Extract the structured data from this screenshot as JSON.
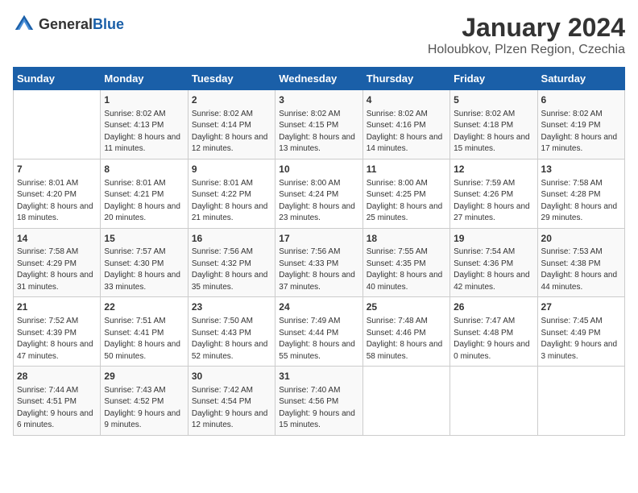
{
  "header": {
    "logo_general": "General",
    "logo_blue": "Blue",
    "title": "January 2024",
    "subtitle": "Holoubkov, Plzen Region, Czechia"
  },
  "days_of_week": [
    "Sunday",
    "Monday",
    "Tuesday",
    "Wednesday",
    "Thursday",
    "Friday",
    "Saturday"
  ],
  "weeks": [
    [
      {
        "day": "",
        "sunrise": "",
        "sunset": "",
        "daylight": ""
      },
      {
        "day": "1",
        "sunrise": "Sunrise: 8:02 AM",
        "sunset": "Sunset: 4:13 PM",
        "daylight": "Daylight: 8 hours and 11 minutes."
      },
      {
        "day": "2",
        "sunrise": "Sunrise: 8:02 AM",
        "sunset": "Sunset: 4:14 PM",
        "daylight": "Daylight: 8 hours and 12 minutes."
      },
      {
        "day": "3",
        "sunrise": "Sunrise: 8:02 AM",
        "sunset": "Sunset: 4:15 PM",
        "daylight": "Daylight: 8 hours and 13 minutes."
      },
      {
        "day": "4",
        "sunrise": "Sunrise: 8:02 AM",
        "sunset": "Sunset: 4:16 PM",
        "daylight": "Daylight: 8 hours and 14 minutes."
      },
      {
        "day": "5",
        "sunrise": "Sunrise: 8:02 AM",
        "sunset": "Sunset: 4:18 PM",
        "daylight": "Daylight: 8 hours and 15 minutes."
      },
      {
        "day": "6",
        "sunrise": "Sunrise: 8:02 AM",
        "sunset": "Sunset: 4:19 PM",
        "daylight": "Daylight: 8 hours and 17 minutes."
      }
    ],
    [
      {
        "day": "7",
        "sunrise": "Sunrise: 8:01 AM",
        "sunset": "Sunset: 4:20 PM",
        "daylight": "Daylight: 8 hours and 18 minutes."
      },
      {
        "day": "8",
        "sunrise": "Sunrise: 8:01 AM",
        "sunset": "Sunset: 4:21 PM",
        "daylight": "Daylight: 8 hours and 20 minutes."
      },
      {
        "day": "9",
        "sunrise": "Sunrise: 8:01 AM",
        "sunset": "Sunset: 4:22 PM",
        "daylight": "Daylight: 8 hours and 21 minutes."
      },
      {
        "day": "10",
        "sunrise": "Sunrise: 8:00 AM",
        "sunset": "Sunset: 4:24 PM",
        "daylight": "Daylight: 8 hours and 23 minutes."
      },
      {
        "day": "11",
        "sunrise": "Sunrise: 8:00 AM",
        "sunset": "Sunset: 4:25 PM",
        "daylight": "Daylight: 8 hours and 25 minutes."
      },
      {
        "day": "12",
        "sunrise": "Sunrise: 7:59 AM",
        "sunset": "Sunset: 4:26 PM",
        "daylight": "Daylight: 8 hours and 27 minutes."
      },
      {
        "day": "13",
        "sunrise": "Sunrise: 7:58 AM",
        "sunset": "Sunset: 4:28 PM",
        "daylight": "Daylight: 8 hours and 29 minutes."
      }
    ],
    [
      {
        "day": "14",
        "sunrise": "Sunrise: 7:58 AM",
        "sunset": "Sunset: 4:29 PM",
        "daylight": "Daylight: 8 hours and 31 minutes."
      },
      {
        "day": "15",
        "sunrise": "Sunrise: 7:57 AM",
        "sunset": "Sunset: 4:30 PM",
        "daylight": "Daylight: 8 hours and 33 minutes."
      },
      {
        "day": "16",
        "sunrise": "Sunrise: 7:56 AM",
        "sunset": "Sunset: 4:32 PM",
        "daylight": "Daylight: 8 hours and 35 minutes."
      },
      {
        "day": "17",
        "sunrise": "Sunrise: 7:56 AM",
        "sunset": "Sunset: 4:33 PM",
        "daylight": "Daylight: 8 hours and 37 minutes."
      },
      {
        "day": "18",
        "sunrise": "Sunrise: 7:55 AM",
        "sunset": "Sunset: 4:35 PM",
        "daylight": "Daylight: 8 hours and 40 minutes."
      },
      {
        "day": "19",
        "sunrise": "Sunrise: 7:54 AM",
        "sunset": "Sunset: 4:36 PM",
        "daylight": "Daylight: 8 hours and 42 minutes."
      },
      {
        "day": "20",
        "sunrise": "Sunrise: 7:53 AM",
        "sunset": "Sunset: 4:38 PM",
        "daylight": "Daylight: 8 hours and 44 minutes."
      }
    ],
    [
      {
        "day": "21",
        "sunrise": "Sunrise: 7:52 AM",
        "sunset": "Sunset: 4:39 PM",
        "daylight": "Daylight: 8 hours and 47 minutes."
      },
      {
        "day": "22",
        "sunrise": "Sunrise: 7:51 AM",
        "sunset": "Sunset: 4:41 PM",
        "daylight": "Daylight: 8 hours and 50 minutes."
      },
      {
        "day": "23",
        "sunrise": "Sunrise: 7:50 AM",
        "sunset": "Sunset: 4:43 PM",
        "daylight": "Daylight: 8 hours and 52 minutes."
      },
      {
        "day": "24",
        "sunrise": "Sunrise: 7:49 AM",
        "sunset": "Sunset: 4:44 PM",
        "daylight": "Daylight: 8 hours and 55 minutes."
      },
      {
        "day": "25",
        "sunrise": "Sunrise: 7:48 AM",
        "sunset": "Sunset: 4:46 PM",
        "daylight": "Daylight: 8 hours and 58 minutes."
      },
      {
        "day": "26",
        "sunrise": "Sunrise: 7:47 AM",
        "sunset": "Sunset: 4:48 PM",
        "daylight": "Daylight: 9 hours and 0 minutes."
      },
      {
        "day": "27",
        "sunrise": "Sunrise: 7:45 AM",
        "sunset": "Sunset: 4:49 PM",
        "daylight": "Daylight: 9 hours and 3 minutes."
      }
    ],
    [
      {
        "day": "28",
        "sunrise": "Sunrise: 7:44 AM",
        "sunset": "Sunset: 4:51 PM",
        "daylight": "Daylight: 9 hours and 6 minutes."
      },
      {
        "day": "29",
        "sunrise": "Sunrise: 7:43 AM",
        "sunset": "Sunset: 4:52 PM",
        "daylight": "Daylight: 9 hours and 9 minutes."
      },
      {
        "day": "30",
        "sunrise": "Sunrise: 7:42 AM",
        "sunset": "Sunset: 4:54 PM",
        "daylight": "Daylight: 9 hours and 12 minutes."
      },
      {
        "day": "31",
        "sunrise": "Sunrise: 7:40 AM",
        "sunset": "Sunset: 4:56 PM",
        "daylight": "Daylight: 9 hours and 15 minutes."
      },
      {
        "day": "",
        "sunrise": "",
        "sunset": "",
        "daylight": ""
      },
      {
        "day": "",
        "sunrise": "",
        "sunset": "",
        "daylight": ""
      },
      {
        "day": "",
        "sunrise": "",
        "sunset": "",
        "daylight": ""
      }
    ]
  ]
}
